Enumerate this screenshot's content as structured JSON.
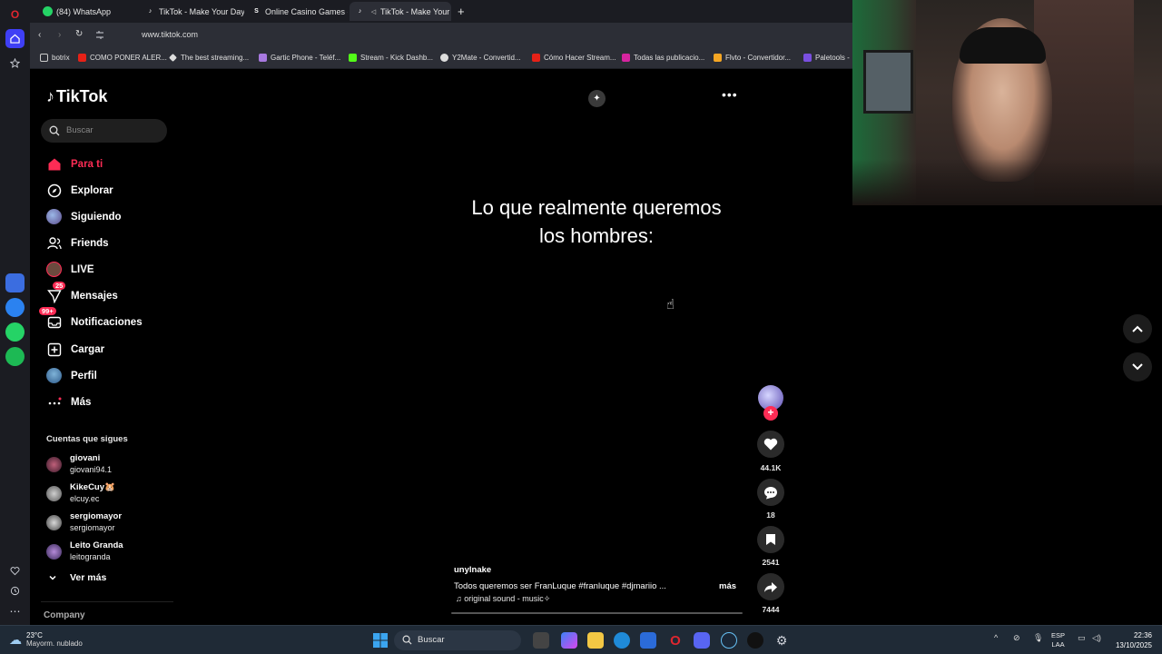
{
  "browser": {
    "tabs": [
      {
        "label": "(84) WhatsApp"
      },
      {
        "label": "TikTok - Make Your Day"
      },
      {
        "label": "Online Casino Games - Pl"
      },
      {
        "label": "TikTok - Make Your Da"
      }
    ],
    "new_tab": "+",
    "url": "www.tiktok.com",
    "bookmarks": [
      "botrix",
      "COMO PONER ALER...",
      "The best streaming...",
      "Gartic Phone - Teléf...",
      "Stream - Kick Dashb...",
      "Y2Mate - Convertid...",
      "Cómo Hacer Stream...",
      "Todas las publicacio...",
      "Flvto - Convertidor...",
      "Paletools -"
    ]
  },
  "tiktok": {
    "logo": "TikTok",
    "search_placeholder": "Buscar",
    "nav": [
      {
        "label": "Para ti"
      },
      {
        "label": "Explorar"
      },
      {
        "label": "Siguiendo"
      },
      {
        "label": "Friends"
      },
      {
        "label": "LIVE"
      },
      {
        "label": "Mensajes",
        "badge": "25"
      },
      {
        "label": "Notificaciones",
        "badge": "99+"
      },
      {
        "label": "Cargar"
      },
      {
        "label": "Perfil"
      },
      {
        "label": "Más"
      }
    ],
    "following_title": "Cuentas que sigues",
    "following": [
      {
        "name": "giovani",
        "handle": "giovani94.1"
      },
      {
        "name": "KikeCuy🐹",
        "handle": "elcuy.ec"
      },
      {
        "name": "sergiomayor",
        "handle": "sergiomayor"
      },
      {
        "name": "Leito Granda",
        "handle": "leitogranda"
      }
    ],
    "see_more": "Ver más",
    "company": "Company",
    "video": {
      "caption_line1": "Lo que realmente queremos",
      "caption_line2": "los hombres:",
      "author": "unylnake",
      "description": "Todos queremos ser FranLuque #franluque  #djmariio  ...",
      "more": "más",
      "sound": "♫ original sound - music✧",
      "likes": "44.1K",
      "comments": "18",
      "saves": "2541",
      "shares": "7444"
    }
  },
  "taskbar": {
    "weather_temp": "23°C",
    "weather_desc": "Mayorm. nublado",
    "search": "Buscar",
    "lang1": "ESP",
    "lang2": "LAA",
    "time": "22:36",
    "date": "13/10/2025"
  },
  "colors": {
    "accent": "#fe2c55",
    "rail": "#1b1c22",
    "toolbar": "#2c2e36"
  }
}
